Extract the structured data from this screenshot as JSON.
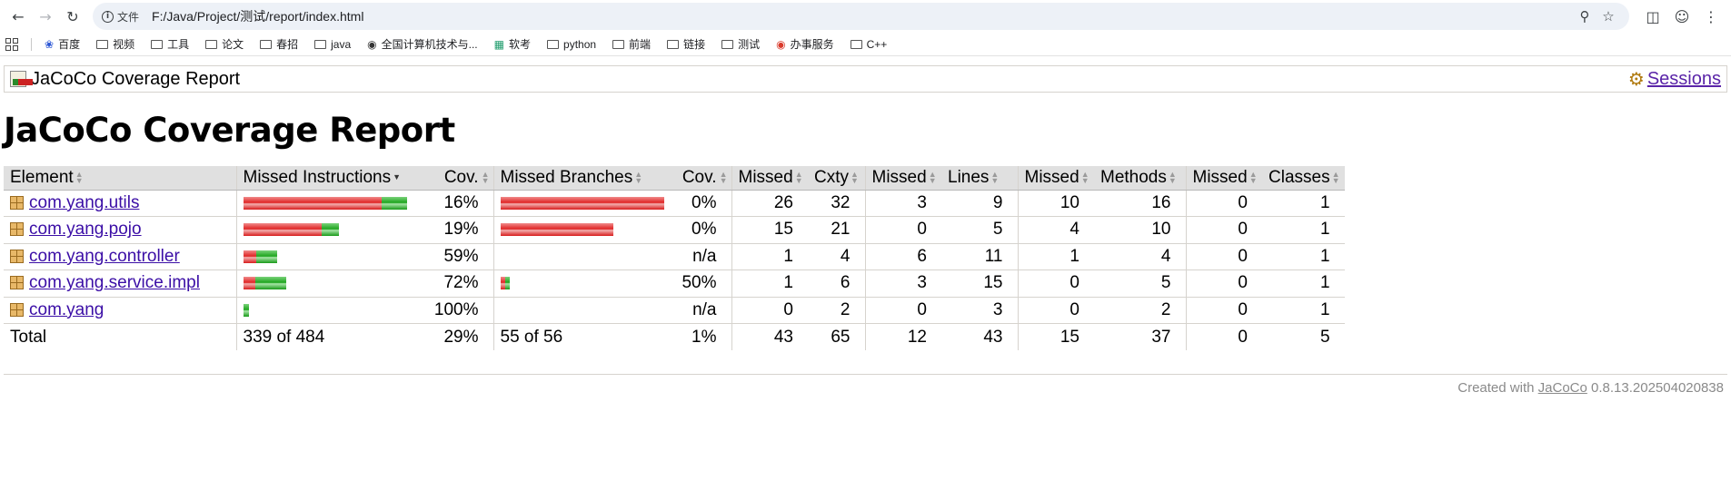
{
  "browser": {
    "address_prefix": "文件",
    "url": "F:/Java/Project/测试/report/index.html",
    "bookmarks": [
      {
        "label": "百度",
        "icon": "baidu-icon"
      },
      {
        "label": "视频",
        "icon": "folder-icon"
      },
      {
        "label": "工具",
        "icon": "folder-icon"
      },
      {
        "label": "论文",
        "icon": "folder-icon"
      },
      {
        "label": "春招",
        "icon": "folder-icon"
      },
      {
        "label": "java",
        "icon": "folder-icon"
      },
      {
        "label": "全国计算机技术与...",
        "icon": "site-icon"
      },
      {
        "label": "软考",
        "icon": "site-icon"
      },
      {
        "label": "python",
        "icon": "folder-icon"
      },
      {
        "label": "前端",
        "icon": "folder-icon"
      },
      {
        "label": "链接",
        "icon": "folder-icon"
      },
      {
        "label": "测试",
        "icon": "folder-icon"
      },
      {
        "label": "办事服务",
        "icon": "site-icon"
      },
      {
        "label": "C++",
        "icon": "folder-icon"
      }
    ]
  },
  "report": {
    "breadcrumb_label": "JaCoCo Coverage Report",
    "sessions_label": "Sessions",
    "title": "JaCoCo Coverage Report",
    "headers": [
      "Element",
      "Missed Instructions",
      "Cov.",
      "Missed Branches",
      "Cov.",
      "Missed",
      "Cxty",
      "Missed",
      "Lines",
      "Missed",
      "Methods",
      "Missed",
      "Classes"
    ],
    "rows": [
      {
        "element": "com.yang.utils",
        "instr_missed_frac": 0.845,
        "instr_covered_frac": 0.155,
        "instr_cov": "16%",
        "br_missed_frac": 1.0,
        "br_covered_frac": 0.0,
        "br_cov": "0%",
        "missed_cxty": "26",
        "cxty": "32",
        "missed_lines": "3",
        "lines": "9",
        "missed_methods": "10",
        "methods": "16",
        "missed_classes": "0",
        "classes": "1"
      },
      {
        "element": "com.yang.pojo",
        "instr_missed_frac": 0.475,
        "instr_covered_frac": 0.105,
        "instr_cov": "19%",
        "br_missed_frac": 0.69,
        "br_covered_frac": 0.0,
        "br_cov": "0%",
        "missed_cxty": "15",
        "cxty": "21",
        "missed_lines": "0",
        "lines": "5",
        "missed_methods": "4",
        "methods": "10",
        "missed_classes": "0",
        "classes": "1"
      },
      {
        "element": "com.yang.controller",
        "instr_missed_frac": 0.08,
        "instr_covered_frac": 0.125,
        "instr_cov": "59%",
        "br_missed_frac": 0.0,
        "br_covered_frac": 0.0,
        "br_cov": "n/a",
        "missed_cxty": "1",
        "cxty": "4",
        "missed_lines": "6",
        "lines": "11",
        "missed_methods": "1",
        "methods": "4",
        "missed_classes": "0",
        "classes": "1"
      },
      {
        "element": "com.yang.service.impl",
        "instr_missed_frac": 0.07,
        "instr_covered_frac": 0.19,
        "instr_cov": "72%",
        "br_missed_frac": 0.025,
        "br_covered_frac": 0.025,
        "br_cov": "50%",
        "missed_cxty": "1",
        "cxty": "6",
        "missed_lines": "3",
        "lines": "15",
        "missed_methods": "0",
        "methods": "5",
        "missed_classes": "0",
        "classes": "1"
      },
      {
        "element": "com.yang",
        "instr_missed_frac": 0.0,
        "instr_covered_frac": 0.035,
        "instr_cov": "100%",
        "br_missed_frac": 0.0,
        "br_covered_frac": 0.0,
        "br_cov": "n/a",
        "missed_cxty": "0",
        "cxty": "2",
        "missed_lines": "0",
        "lines": "3",
        "missed_methods": "0",
        "methods": "2",
        "missed_classes": "0",
        "classes": "1"
      }
    ],
    "total": {
      "label": "Total",
      "instr": "339 of 484",
      "instr_cov": "29%",
      "br": "55 of 56",
      "br_cov": "1%",
      "missed_cxty": "43",
      "cxty": "65",
      "missed_lines": "12",
      "lines": "43",
      "missed_methods": "15",
      "methods": "37",
      "missed_classes": "0",
      "classes": "5"
    },
    "footer_prefix": "Created with",
    "footer_link": "JaCoCo",
    "footer_version": "0.8.13.202504020838"
  },
  "colors": {
    "bar_red": "#e02424",
    "bar_green": "#1ea51e",
    "link": "#3b0ea6"
  }
}
